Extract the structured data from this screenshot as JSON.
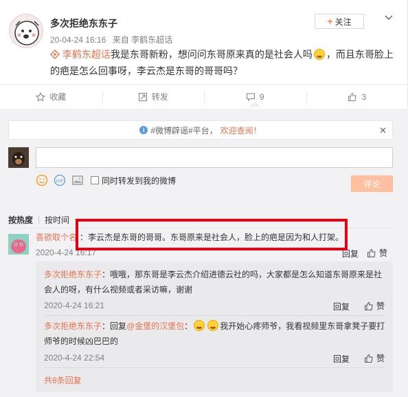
{
  "post": {
    "username": "多次拒绝东东子",
    "time": "20-04-24 16:16",
    "source": "来自 李鹤东超话",
    "follow_label": "关注",
    "topic_tag": "李鹤东超话",
    "text_part1": "我是东哥新粉，想问问东哥原来真的是社会人吗",
    "text_part2": "，而且东哥脸上的疤是怎么回事呀，李云杰是东哥的哥哥吗？"
  },
  "actions": {
    "favorite": "收藏",
    "forward": "转发",
    "comment_count": "9",
    "like_count": "3"
  },
  "notice": {
    "prefix": "#微博辟谣#平台，",
    "link": "欢迎查阅！"
  },
  "composer": {
    "forward_label": "同时转发到我的微博",
    "submit_label": "评论"
  },
  "sort": {
    "hot": "按热度",
    "time": "按时间"
  },
  "comments": [
    {
      "name": "喜欲取个名",
      "text": "：李云杰是东哥的哥哥。东哥原来是社会人，脸上的疤是因为和人打架。",
      "time": "2020-4-24 16:17",
      "reply": "回复",
      "like": "赞"
    }
  ],
  "replies": [
    {
      "name": "多次拒绝东东子",
      "text": "：哦哦，那东哥是李云杰介绍进德云社的吗，大家都是怎么知道东哥原来是社会人的呀，有什么视频或者采访嘛，谢谢",
      "time": "2020-4-24 16:21",
      "reply": "回复",
      "like": "赞"
    },
    {
      "name": "多次拒绝东东子",
      "text_a": "：回复",
      "mention": "@金堡的汉堡包",
      "text_b": "：",
      "text_c": "我开始心疼师爷，我看视频里东哥拿凳子要打师爷的时候凶巴巴的",
      "time": "2020-4-24 22:54",
      "reply": "回复",
      "like": "赞"
    }
  ],
  "more_replies": "共8条回复",
  "colors": {
    "accent": "#eb7350",
    "highlight_box": "#e60012"
  }
}
